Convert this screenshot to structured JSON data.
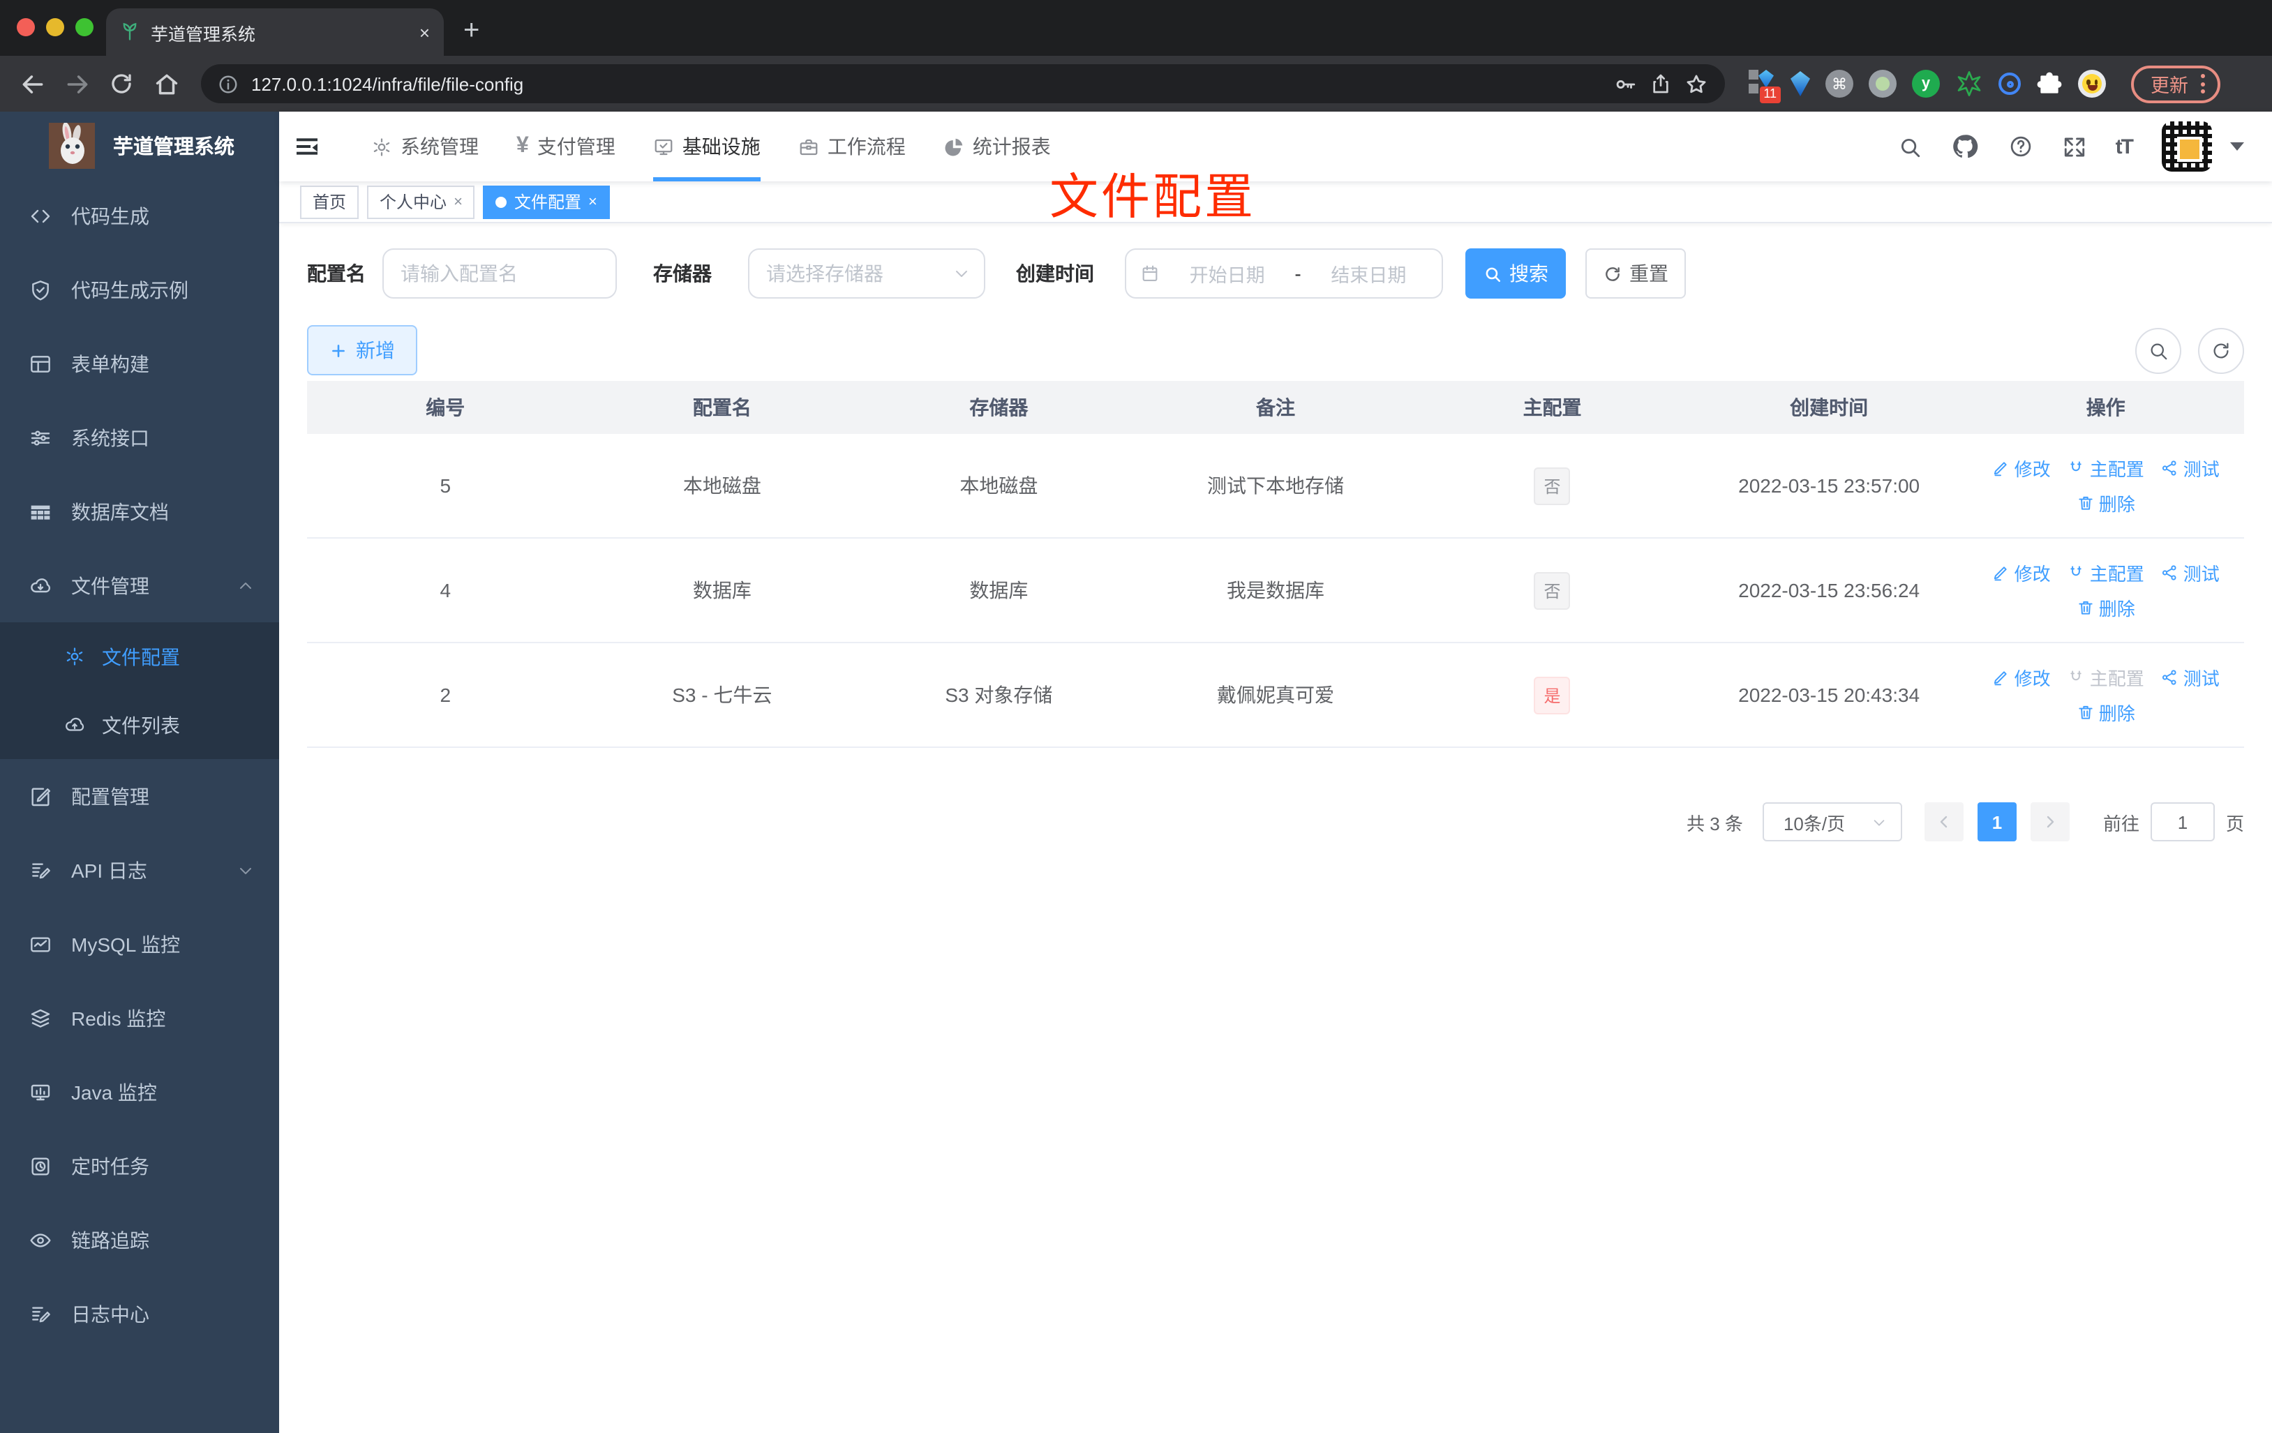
{
  "browser": {
    "tab_title": "芋道管理系统",
    "close_glyph": "×",
    "new_tab_glyph": "+",
    "url": "127.0.0.1:1024/infra/file/file-config",
    "ext_badge": "11",
    "cmd_glyph": "⌘",
    "ext_letter": "y",
    "update_label": "更新"
  },
  "sidebar": {
    "title": "芋道管理系统",
    "items": [
      "代码生成",
      "代码生成示例",
      "表单构建",
      "系统接口",
      "数据库文档",
      "文件管理",
      "文件配置",
      "文件列表",
      "配置管理",
      "API 日志",
      "MySQL 监控",
      "Redis 监控",
      "Java 监控",
      "定时任务",
      "链路追踪",
      "日志中心"
    ]
  },
  "navbar": {
    "items": [
      "系统管理",
      "支付管理",
      "基础设施",
      "工作流程",
      "统计报表"
    ],
    "yen_glyph": "¥",
    "font_size_icon": "tT"
  },
  "tags": [
    "首页",
    "个人中心",
    "文件配置"
  ],
  "annotation": {
    "text": "文件配置",
    "color": "#fe2c00"
  },
  "filters": {
    "name_label": "配置名",
    "name_placeholder": "请输入配置名",
    "storage_label": "存储器",
    "storage_placeholder": "请选择存储器",
    "time_label": "创建时间",
    "start_placeholder": "开始日期",
    "separator": "-",
    "end_placeholder": "结束日期",
    "search_label": "搜索",
    "reset_label": "重置"
  },
  "toolbar": {
    "add_label": "新增"
  },
  "table": {
    "headers": [
      "编号",
      "配置名",
      "存储器",
      "备注",
      "主配置",
      "创建时间",
      "操作"
    ],
    "action_labels": {
      "edit": "修改",
      "master": "主配置",
      "test": "测试",
      "del": "删除"
    },
    "rows": [
      {
        "id": "5",
        "name": "本地磁盘",
        "storage": "本地磁盘",
        "remark": "测试下本地存储",
        "master": "否",
        "master_type": "info",
        "created": "2022-03-15 23:57:00"
      },
      {
        "id": "4",
        "name": "数据库",
        "storage": "数据库",
        "remark": "我是数据库",
        "master": "否",
        "master_type": "info",
        "created": "2022-03-15 23:56:24"
      },
      {
        "id": "2",
        "name": "S3 - 七牛云",
        "storage": "S3 对象存储",
        "remark": "戴佩妮真可爱",
        "master": "是",
        "master_type": "danger",
        "created": "2022-03-15 20:43:34"
      }
    ]
  },
  "pagination": {
    "total": "共 3 条",
    "page_size": "10条/页",
    "current_page": "1",
    "goto_label": "前往",
    "goto_value": "1",
    "unit_label": "页"
  },
  "colors": {
    "primary": "#409eff",
    "sidebar_bg": "#304156",
    "submenu_bg": "#263445",
    "annotation": "#fe2c00",
    "tag_info_text": "#909399",
    "tag_danger_text": "#f56c6c"
  }
}
